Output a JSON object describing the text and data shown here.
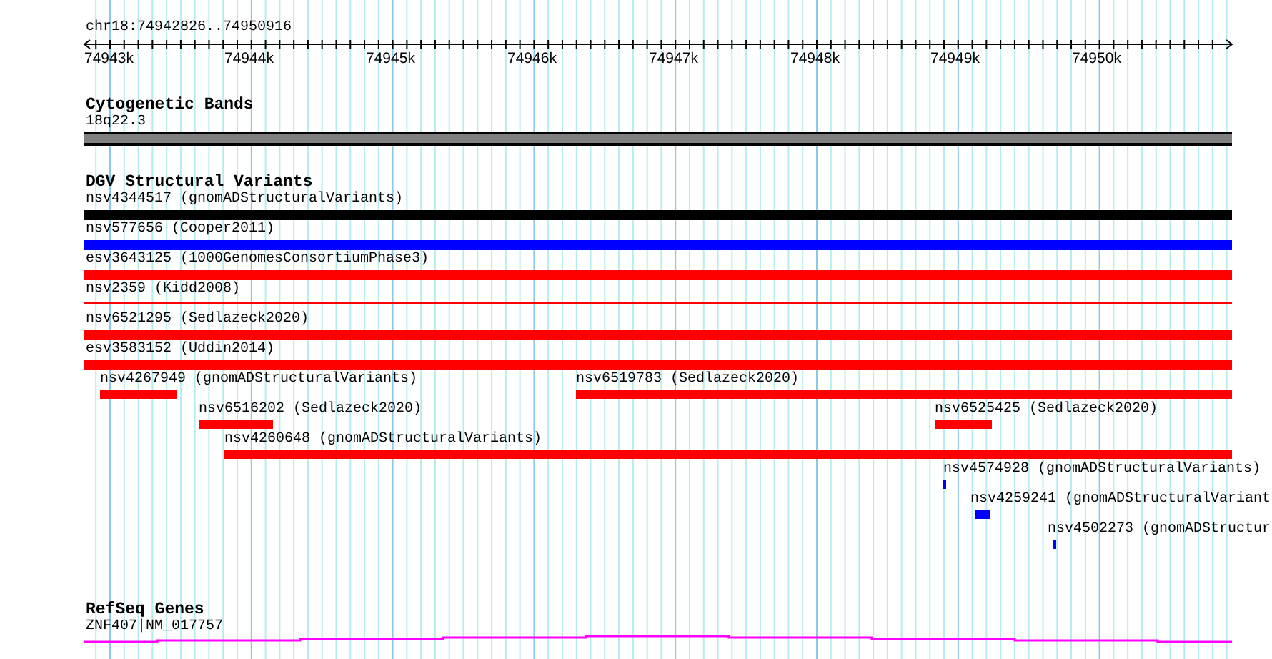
{
  "ruler": {
    "location": "chr18:74942826..74950916",
    "labels": [
      "74943k",
      "74944k",
      "74945k",
      "74946k",
      "74947k",
      "74948k",
      "74949k",
      "74950k"
    ]
  },
  "tracks": [
    {
      "kind": "bands",
      "title": "Cytogenetic Bands",
      "items": [
        {
          "label": "18q22.3",
          "color": "#808080"
        }
      ]
    },
    {
      "kind": "variants",
      "title": "DGV Structural Variants",
      "items": [
        {
          "label": "nsv4344517 (gnomADStructuralVariants)",
          "color": "#000000"
        },
        {
          "label": "nsv577656 (Cooper2011)",
          "color": "#0000ff"
        },
        {
          "label": "esv3643125 (1000GenomesConsortiumPhase3)",
          "color": "#ff0000"
        },
        {
          "label": "nsv2359 (Kidd2008)",
          "color": "#ff0000"
        },
        {
          "label": "nsv6521295 (Sedlazeck2020)",
          "color": "#ff0000"
        },
        {
          "label": "esv3583152 (Uddin2014)",
          "color": "#ff0000"
        },
        {
          "label": "nsv4267949 (gnomADStructuralVariants)",
          "color": "#ff0000"
        },
        {
          "label": "nsv6519783 (Sedlazeck2020)",
          "color": "#ff0000"
        },
        {
          "label": "nsv6516202 (Sedlazeck2020)",
          "color": "#ff0000"
        },
        {
          "label": "nsv6525425 (Sedlazeck2020)",
          "color": "#ff0000"
        },
        {
          "label": "nsv4260648 (gnomADStructuralVariants)",
          "color": "#ff0000"
        },
        {
          "label": "nsv4574928 (gnomADStructuralVariants)",
          "color": "#0000ff"
        },
        {
          "label": "nsv4259241 (gnomADStructuralVariant",
          "color": "#0000ff"
        },
        {
          "label": "nsv4502273 (gnomADStructur",
          "color": "#0000ff"
        }
      ]
    },
    {
      "kind": "genes",
      "title": "RefSeq Genes",
      "items": [
        {
          "label": "ZNF407|NM_017757",
          "color": "#ff00ff"
        }
      ]
    }
  ]
}
